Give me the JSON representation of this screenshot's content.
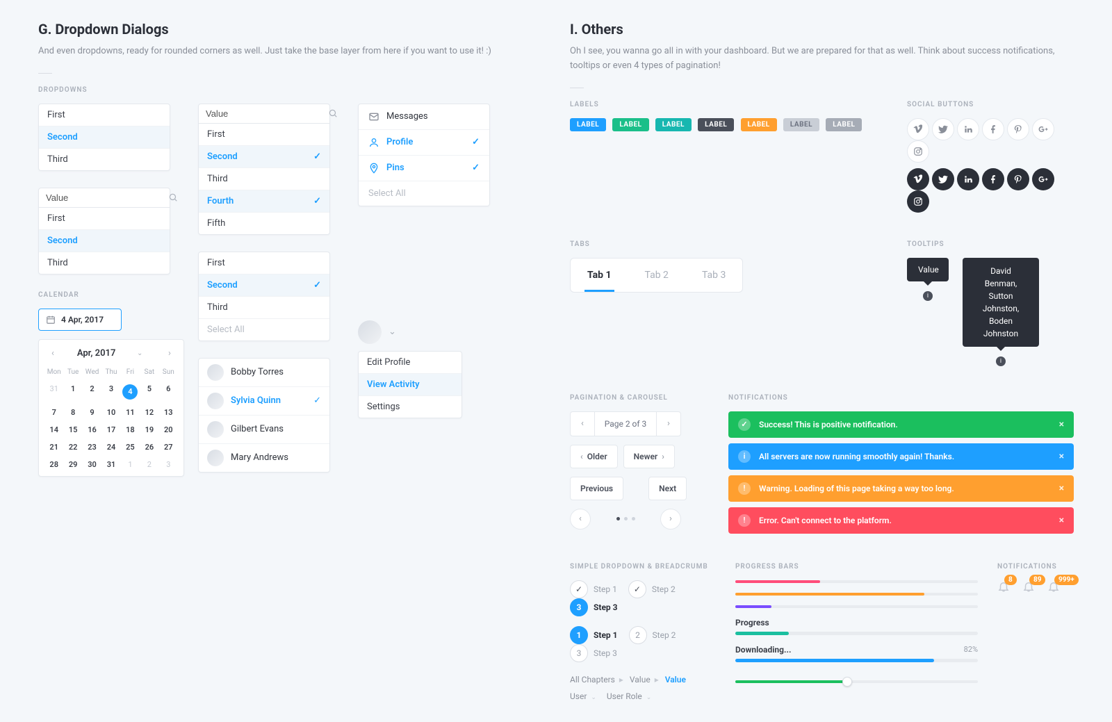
{
  "left": {
    "heading": "G. Dropdown Dialogs",
    "lead": "And even dropdowns, ready for rounded corners as well. Just take the base layer from here if you want to use it! :)",
    "dropdowns_label": "DROPDOWNS",
    "calendar_label": "CALENDAR",
    "simple_options": [
      "First",
      "Second",
      "Third"
    ],
    "input_value_label": "Value",
    "long_list": [
      {
        "t": "First",
        "sel": false
      },
      {
        "t": "Second",
        "sel": true
      },
      {
        "t": "Third",
        "sel": false
      },
      {
        "t": "Fourth",
        "sel": true
      },
      {
        "t": "Fifth",
        "sel": false
      }
    ],
    "select_all": "Select All",
    "people": [
      "Bobby Torres",
      "Sylvia Quinn",
      "Gilbert Evans",
      "Mary Andrews"
    ],
    "people_sel_index": 1,
    "menu_mail": [
      {
        "t": "Messages",
        "icon": "mail",
        "sel": false,
        "chk": false
      },
      {
        "t": "Profile",
        "icon": "user",
        "sel": true,
        "chk": true
      },
      {
        "t": "Pins",
        "icon": "pin",
        "sel": true,
        "chk": true
      }
    ],
    "profile_menu": [
      "Edit Profile",
      "View Activity",
      "Settings"
    ],
    "profile_menu_sel": 1,
    "date_value": "4 Apr, 2017",
    "calendar": {
      "title": "Apr, 2017",
      "dows": [
        "Mon",
        "Tue",
        "Wed",
        "Thu",
        "Fri",
        "Sat",
        "Sun"
      ],
      "days": [
        {
          "n": "31",
          "mute": true
        },
        {
          "n": "1"
        },
        {
          "n": "2"
        },
        {
          "n": "3"
        },
        {
          "n": "4",
          "sel": true
        },
        {
          "n": "5"
        },
        {
          "n": "6"
        },
        {
          "n": "7"
        },
        {
          "n": "8"
        },
        {
          "n": "9"
        },
        {
          "n": "10"
        },
        {
          "n": "11"
        },
        {
          "n": "12"
        },
        {
          "n": "13"
        },
        {
          "n": "14"
        },
        {
          "n": "15"
        },
        {
          "n": "16"
        },
        {
          "n": "17"
        },
        {
          "n": "18"
        },
        {
          "n": "19"
        },
        {
          "n": "20"
        },
        {
          "n": "21"
        },
        {
          "n": "22"
        },
        {
          "n": "23"
        },
        {
          "n": "24"
        },
        {
          "n": "25"
        },
        {
          "n": "26"
        },
        {
          "n": "27"
        },
        {
          "n": "28"
        },
        {
          "n": "29"
        },
        {
          "n": "30"
        },
        {
          "n": "31"
        },
        {
          "n": "1",
          "mute": true
        },
        {
          "n": "2",
          "mute": true
        },
        {
          "n": "3",
          "mute": true
        }
      ]
    }
  },
  "right": {
    "heading": "I. Others",
    "lead": "Oh I see, you wanna go all in with your dashboard. But we are prepared for that as well. Think about success notifications, tooltips or even 4 types of pagination!",
    "labels_label": "LABELS",
    "social_label": "SOCIAL BUTTONS",
    "tabs_label": "TABS",
    "tooltips_label": "TOOLTIPS",
    "pagination_label": "PAGINATION & CAROUSEL",
    "notifications_label": "NOTIFICATIONS",
    "simpledd_label": "SIMPLE DROPDOWN & BREADCRUMB",
    "progress_label": "PROGRESS BARS",
    "notif_count_label": "NOTIFICATIONS",
    "tags": [
      "LABEL",
      "LABEL",
      "LABEL",
      "LABEL",
      "LABEL",
      "LABEL",
      "LABEL"
    ],
    "tabs": [
      "Tab 1",
      "Tab 2",
      "Tab 3"
    ],
    "tooltip_single": "Value",
    "tooltip_multi": [
      "David Benman,",
      "Sutton Johnston,",
      "Boden Johnston"
    ],
    "pin_i": "i",
    "page_of": "Page 2 of 3",
    "older": "Older",
    "newer": "Newer",
    "previous": "Previous",
    "next": "Next",
    "steps_a": [
      {
        "t": "Step 1",
        "mode": "done"
      },
      {
        "t": "Step 2",
        "mode": "done"
      },
      {
        "t": "Step 3",
        "mode": "active",
        "n": "3"
      }
    ],
    "steps_b": [
      {
        "t": "Step 1",
        "mode": "active",
        "n": "1"
      },
      {
        "t": "Step 2",
        "mode": "idle",
        "n": "2"
      },
      {
        "t": "Step 3",
        "mode": "idle",
        "n": "3"
      }
    ],
    "notifs": [
      {
        "type": "success",
        "t": "Success! This is positive notification."
      },
      {
        "type": "info",
        "t": "All servers are now running smoothly again! Thanks."
      },
      {
        "type": "warn",
        "t": "Warning. Loading of this page taking a way too long."
      },
      {
        "type": "err",
        "t": "Error. Can't connect to the platform."
      }
    ],
    "crumb_a": {
      "p1": "All Chapters",
      "p2": "Value",
      "cur": "Value"
    },
    "crumb_b": {
      "p1": "User",
      "p2": "User Role"
    },
    "progress": {
      "bars": [
        {
          "color": "c-pink",
          "pct": 35
        },
        {
          "color": "c-orange",
          "pct": 78
        },
        {
          "color": "c-purple",
          "pct": 15
        }
      ],
      "named1_label": "Progress",
      "named1_pct": 22,
      "named2_label": "Downloading...",
      "named2_pct_text": "82%",
      "named2_pct": 82,
      "slider_pct": 46
    },
    "bells": [
      "8",
      "89",
      "999+"
    ]
  }
}
